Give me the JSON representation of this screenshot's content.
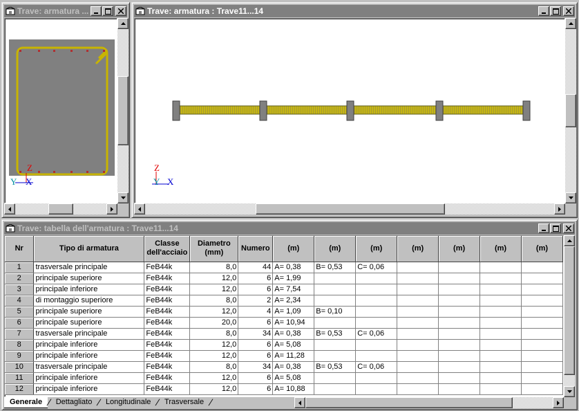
{
  "windows": {
    "section": {
      "title": "Trave: armatura ..."
    },
    "view": {
      "title": "Trave: armatura : Trave11...14"
    },
    "table": {
      "title": "Trave: tabella dell'armatura : Trave11...14"
    }
  },
  "axes": {
    "z": "Z",
    "y": "Y",
    "x": "X"
  },
  "colors": {
    "rebar": "#c8b400",
    "section_fill": "#808080",
    "rebar_dot": "#b03030",
    "axis_z": "#e00000",
    "axis_y": "#0090a0",
    "axis_x": "#0000d0"
  },
  "icons": {
    "window": "building-icon",
    "minimize": "minimize-icon",
    "maximize": "maximize-icon",
    "close": "close-icon"
  },
  "table": {
    "headers": [
      "Nr",
      "Tipo di armatura",
      "Classe dell'acciaio",
      "Diametro (mm)",
      "Numero",
      "(m)",
      "(m)",
      "(m)",
      "(m)",
      "(m)",
      "(m)",
      "(m)"
    ],
    "rows": [
      [
        "1",
        "trasversale principale",
        "FeB44k",
        "8,0",
        "44",
        "A= 0,38",
        "B= 0,53",
        "C= 0,06",
        "",
        "",
        "",
        ""
      ],
      [
        "2",
        "principale superiore",
        "FeB44k",
        "12,0",
        "6",
        "A= 1,99",
        "",
        "",
        "",
        "",
        "",
        ""
      ],
      [
        "3",
        "principale inferiore",
        "FeB44k",
        "12,0",
        "6",
        "A= 7,54",
        "",
        "",
        "",
        "",
        "",
        ""
      ],
      [
        "4",
        "di montaggio superiore",
        "FeB44k",
        "8,0",
        "2",
        "A= 2,34",
        "",
        "",
        "",
        "",
        "",
        ""
      ],
      [
        "5",
        "principale superiore",
        "FeB44k",
        "12,0",
        "4",
        "A= 1,09",
        "B= 0,10",
        "",
        "",
        "",
        "",
        ""
      ],
      [
        "6",
        "principale superiore",
        "FeB44k",
        "20,0",
        "6",
        "A= 10,94",
        "",
        "",
        "",
        "",
        "",
        ""
      ],
      [
        "7",
        "trasversale principale",
        "FeB44k",
        "8,0",
        "34",
        "A= 0,38",
        "B= 0,53",
        "C= 0,06",
        "",
        "",
        "",
        ""
      ],
      [
        "8",
        "principale inferiore",
        "FeB44k",
        "12,0",
        "6",
        "A= 5,08",
        "",
        "",
        "",
        "",
        "",
        ""
      ],
      [
        "9",
        "principale inferiore",
        "FeB44k",
        "12,0",
        "6",
        "A= 11,28",
        "",
        "",
        "",
        "",
        "",
        ""
      ],
      [
        "10",
        "trasversale principale",
        "FeB44k",
        "8,0",
        "34",
        "A= 0,38",
        "B= 0,53",
        "C= 0,06",
        "",
        "",
        "",
        ""
      ],
      [
        "11",
        "principale inferiore",
        "FeB44k",
        "12,0",
        "6",
        "A= 5,08",
        "",
        "",
        "",
        "",
        "",
        ""
      ],
      [
        "12",
        "principale inferiore",
        "FeB44k",
        "12,0",
        "6",
        "A= 10,88",
        "",
        "",
        "",
        "",
        "",
        ""
      ]
    ]
  },
  "tabs": [
    "Generale",
    "Dettagliato",
    "Longitudinale",
    "Trasversale"
  ],
  "selected_tab": "Generale"
}
